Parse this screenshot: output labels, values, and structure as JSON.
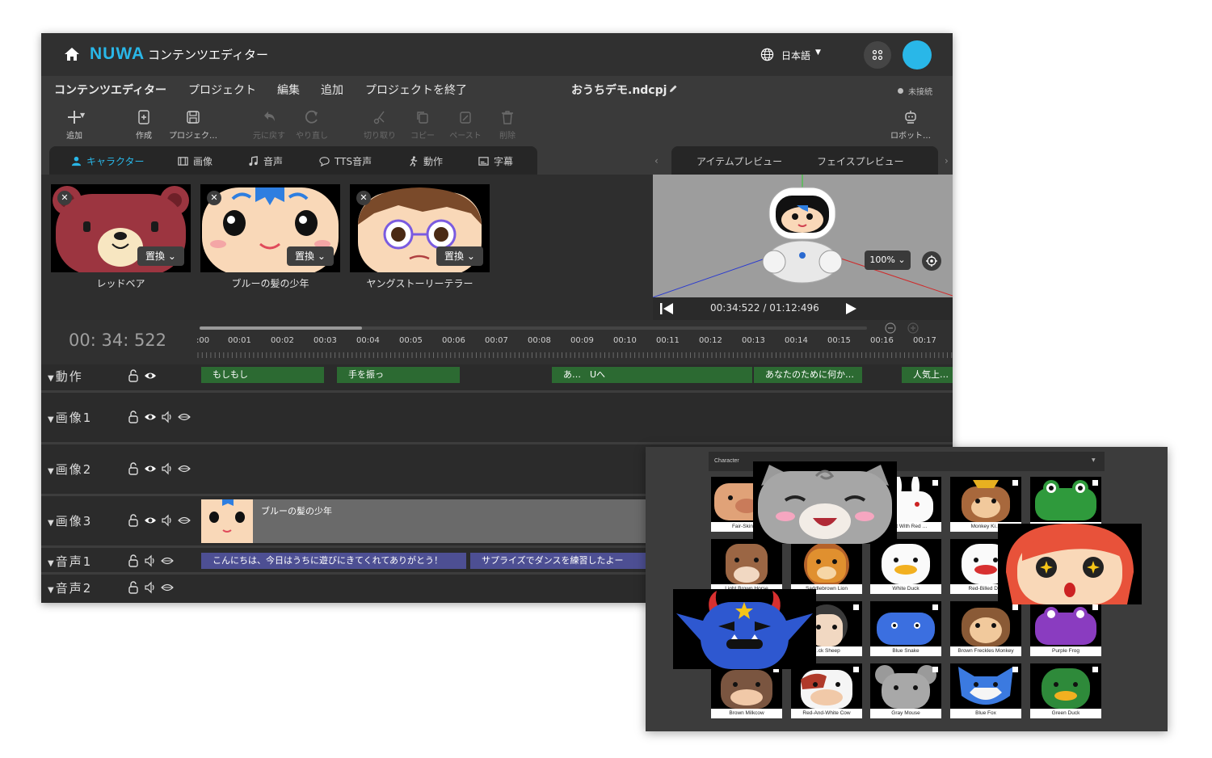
{
  "app": {
    "brand": "NUWA",
    "title": "コンテンツエディター",
    "language": "日本語"
  },
  "menu": {
    "items": [
      "コンテンツエディター",
      "プロジェクト",
      "編集",
      "追加",
      "プロジェクトを終了"
    ],
    "filename": "おうちデモ.ndcpj",
    "status": "未接続"
  },
  "toolbar": {
    "add": "追加",
    "create": "作成",
    "project": "プロジェク…",
    "undo": "元に戻す",
    "redo": "やり直し",
    "cut": "切り取り",
    "copy": "コピー",
    "paste": "ペースト",
    "delete": "削除",
    "robot": "ロボット…"
  },
  "tabs": [
    "キャラクター",
    "画像",
    "音声",
    "TTS音声",
    "動作",
    "字幕"
  ],
  "preview_tabs": [
    "アイテムプレビュー",
    "フェイスプレビュー"
  ],
  "characters": [
    {
      "name": "レッドベア",
      "replace": "置換"
    },
    {
      "name": "ブルーの髪の少年",
      "replace": "置換"
    },
    {
      "name": "ヤングストーリーテラー",
      "replace": "置換"
    }
  ],
  "preview": {
    "zoom": "100%",
    "time": "00:34:522 / 01:12:496"
  },
  "timeline": {
    "current": "00: 34: 522",
    "ticks": [
      ":00",
      "00:01",
      "00:02",
      "00:03",
      "00:04",
      "00:05",
      "00:06",
      "00:07",
      "00:08",
      "00:09",
      "00:10",
      "00:11",
      "00:12",
      "00:13",
      "00:14",
      "00:15",
      "00:16",
      "00:17"
    ],
    "tracks": {
      "motion": "動作",
      "image1": "画像1",
      "image2": "画像2",
      "image3": "画像3",
      "audio1": "音声1",
      "audio2": "音声2"
    },
    "motion_clips": [
      "もしもし",
      "手を振っ",
      "あ…　Uへ",
      "あなたのために何か…",
      "人気上…"
    ],
    "image3_clip": "ブルーの髪の少年",
    "audio_clips": [
      "こんにちは、今日はうちに遊びにきてくれてありがとう！",
      "サプライズでダンスを練習したよー"
    ]
  },
  "picker": {
    "dropdown": "Character",
    "items": [
      [
        "Fair-Skinn…",
        "…bbit With Red …",
        "Monkey Ki…",
        ""
      ],
      [
        "Light Brown Horse",
        "Saddlebrown Lion",
        "White Duck",
        "Red-Billed D…",
        ""
      ],
      [
        "…ck Sheep",
        "Blue Snake",
        "Brown Freckles Monkey",
        "Purple Frog"
      ],
      [
        "Brown Milkcow",
        "Red-And-White Cow",
        "Gray Mouse",
        "Blue Fox",
        "Green Duck"
      ]
    ]
  },
  "colors": {
    "accent": "#29b7e8",
    "motion_clip": "#2c6a32",
    "audio_clip": "#4d4f93",
    "background": "#2b2b2b"
  }
}
